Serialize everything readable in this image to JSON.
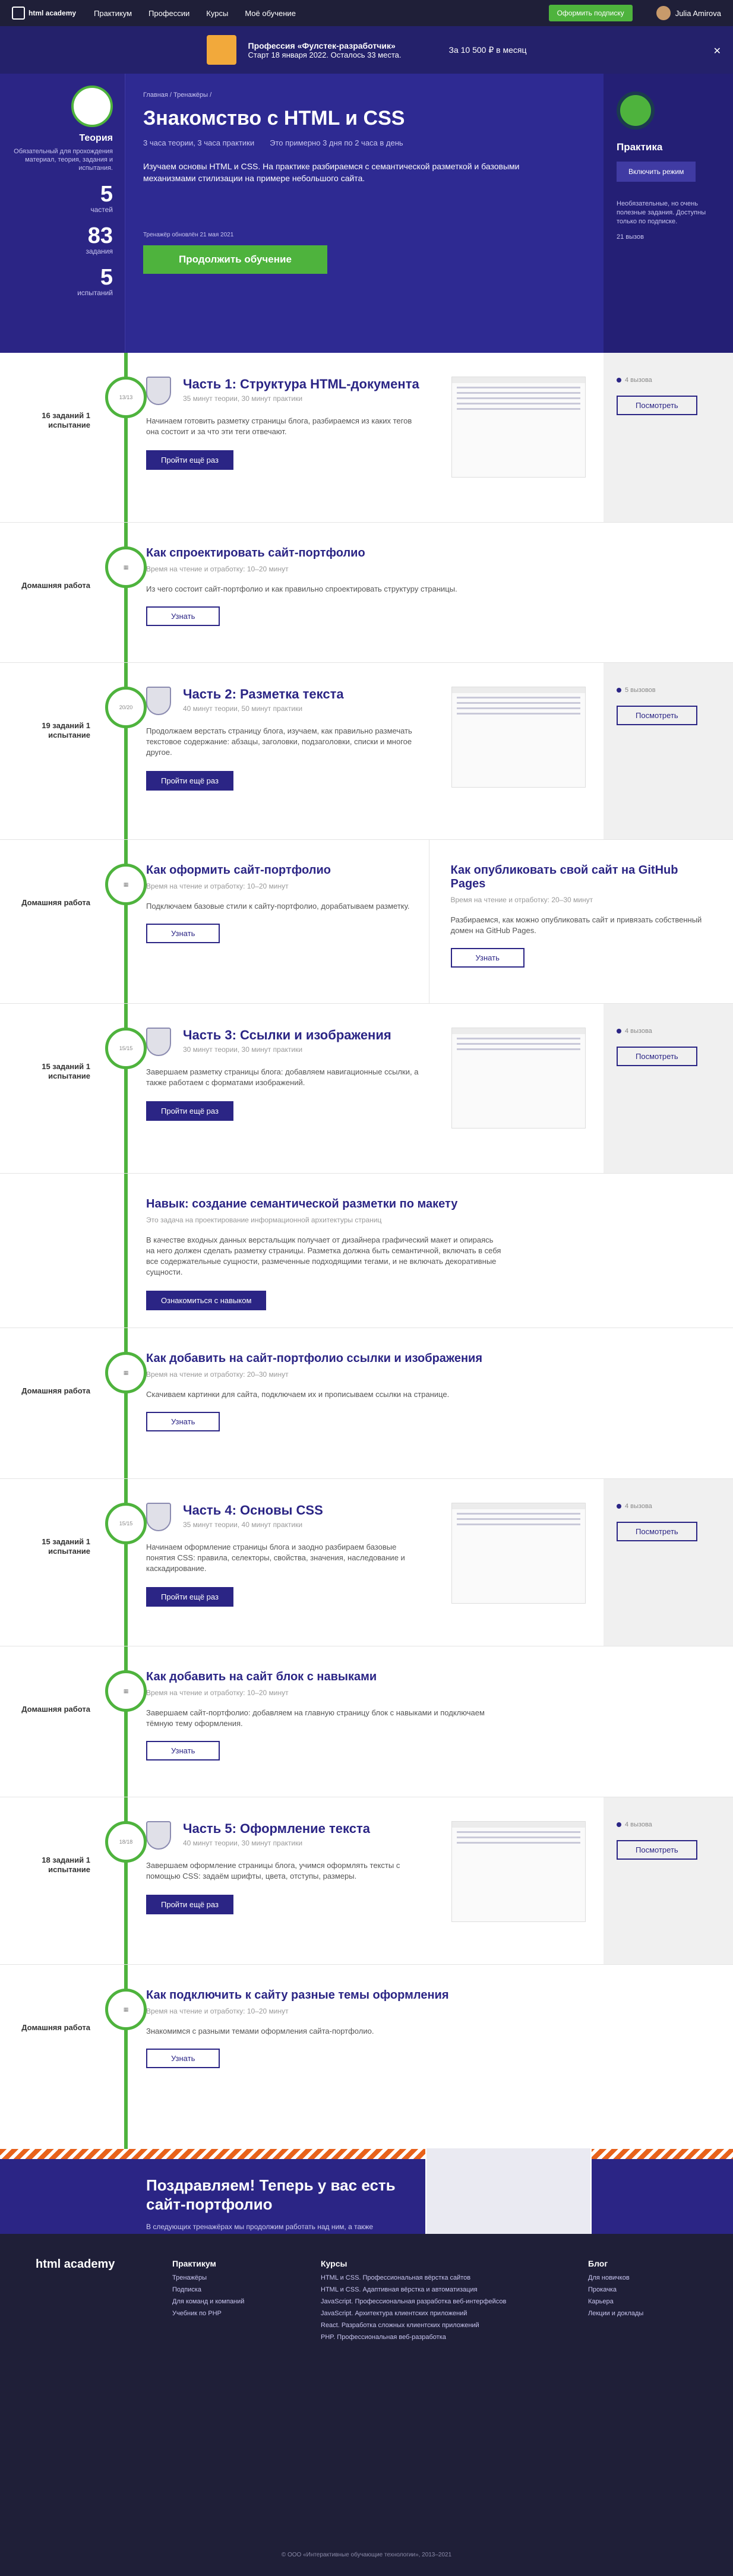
{
  "nav": {
    "logo": "html academy",
    "items": [
      "Практикум",
      "Профессии",
      "Курсы",
      "Моё обучение"
    ],
    "subscribe": "Оформить подписку",
    "user": "Julia Amirova"
  },
  "promo": {
    "title": "Профессия «Фулстек-разработчик»",
    "subtitle": "Старт 18 января 2022. Осталось 33 места.",
    "price": "За 10 500 ₽ в месяц"
  },
  "hero": {
    "theory_title": "Теория",
    "theory_desc": "Обязательный для прохождения материал, теория, задания и испытания.",
    "stats": [
      {
        "num": "5",
        "label": "частей"
      },
      {
        "num": "83",
        "label": "задания"
      },
      {
        "num": "5",
        "label": "испытаний"
      }
    ],
    "breadcrumbs": "Главная / Тренажёры /",
    "title": "Знакомство с HTML и CSS",
    "meta_1": "3 часа теории, 3 часа практики",
    "meta_2": "Это примерно 3 дня по 2 часа в день",
    "text": "Изучаем основы HTML и CSS. На практике разбираемся с семантической разметкой и базовыми механизмами стилизации на примере небольшого сайта.",
    "updated": "Тренажёр обновлён 21 мая 2021",
    "start": "Продолжить обучение",
    "practice_title": "Практика",
    "practice_btn": "Включить режим",
    "practice_text": "Необязательные, но очень полезные задания. Доступны только по подписке.",
    "practice_views": "21 вызов"
  },
  "sections": [
    {
      "label": "16 заданий 1 испытание",
      "title": "Часть 1: Структура HTML-документа",
      "meta": "35 минут теории, 30 минут практики",
      "text": "Начинаем готовить разметку страницы блога, разбираемся из каких тегов она состоит и за что эти теги отвечают.",
      "btn": "Пройти ещё раз",
      "views": "4 вызова",
      "side_btn": "Посмотреть"
    },
    {
      "label": "Домашняя работа",
      "title": "Как спроектировать сайт-портфолио",
      "meta": "Время на чтение и отработку: 10–20 минут",
      "text": "Из чего состоит сайт-портфолио и как правильно спроектировать структуру страницы.",
      "btn": "Узнать"
    },
    {
      "label": "19 заданий 1 испытание",
      "title": "Часть 2: Разметка текста",
      "meta": "40 минут теории, 50 минут практики",
      "text": "Продолжаем верстать страницу блога, изучаем, как правильно размечать текстовое содержание: абзацы, заголовки, подзаголовки, списки и многое другое.",
      "btn": "Пройти ещё раз",
      "views": "5 вызовов",
      "side_btn": "Посмотреть"
    },
    {
      "label": "Домашняя работа",
      "title": "Как оформить сайт-портфолио",
      "meta": "Время на чтение и отработку: 10–20 минут",
      "text": "Подключаем базовые стили к сайту-портфолио, дорабатываем разметку.",
      "btn": "Узнать",
      "title2": "Как опубликовать свой сайт на GitHub Pages",
      "meta2": "Время на чтение и отработку: 20–30 минут",
      "text2": "Разбираемся, как можно опубликовать сайт и привязать собственный домен на GitHub Pages.",
      "btn2": "Узнать"
    },
    {
      "label": "15 заданий 1 испытание",
      "title": "Часть 3: Ссылки и изображения",
      "meta": "30 минут теории, 30 минут практики",
      "text": "Завершаем разметку страницы блога: добавляем навигационные ссылки, а также работаем с форматами изображений.",
      "btn": "Пройти ещё раз",
      "views": "4 вызова",
      "side_btn": "Посмотреть"
    },
    {
      "label": "",
      "title": "Навык: создание семантической разметки по макету",
      "meta": "Это задача на проектирование информационной архитектуры страниц",
      "text": "В качестве входных данных верстальщик получает от дизайнера графический макет и опираясь на него должен сделать разметку страницы. Разметка должна быть семантичной, включать в себя все содержательные сущности, размеченные подходящими тегами, и не включать декоративные сущности.",
      "btn": "Ознакомиться с навыком"
    },
    {
      "label": "Домашняя работа",
      "title": "Как добавить на сайт-портфолио ссылки и изображения",
      "meta": "Время на чтение и отработку: 20–30 минут",
      "text": "Скачиваем картинки для сайта, подключаем их и прописываем ссылки на странице.",
      "btn": "Узнать"
    },
    {
      "label": "15 заданий 1 испытание",
      "title": "Часть 4: Основы CSS",
      "meta": "35 минут теории, 40 минут практики",
      "text": "Начинаем оформление страницы блога и заодно разбираем базовые понятия CSS: правила, селекторы, свойства, значения, наследование и каскадирование.",
      "btn": "Пройти ещё раз",
      "views": "4 вызова",
      "side_btn": "Посмотреть"
    },
    {
      "label": "Домашняя работа",
      "title": "Как добавить на сайт блок с навыками",
      "meta": "Время на чтение и отработку: 10–20 минут",
      "text": "Завершаем сайт-портфолио: добавляем на главную страницу блок с навыками и подключаем тёмную тему оформления.",
      "btn": "Узнать"
    },
    {
      "label": "18 заданий 1 испытание",
      "title": "Часть 5: Оформление текста",
      "meta": "40 минут теории, 30 минут практики",
      "text": "Завершаем оформление страницы блога, учимся оформлять тексты с помощью CSS: задаём шрифты, цвета, отступы, размеры.",
      "btn": "Пройти ещё раз",
      "views": "4 вызова",
      "side_btn": "Посмотреть"
    },
    {
      "label": "Домашняя работа",
      "title": "Как подключить к сайту разные темы оформления",
      "meta": "Время на чтение и отработку: 10–20 минут",
      "text": "Знакомимся с разными темами оформления сайта-портфолио.",
      "btn": "Узнать"
    }
  ],
  "congrats": {
    "title": "Поздравляем! Теперь у вас есть сайт-портфолио",
    "text": "В следующих тренажёрах мы продолжим работать над ним, а также дополним портфолио новыми проектами."
  },
  "footer": {
    "cols": [
      {
        "title": "Практикум",
        "items": [
          "Тренажёры",
          "Подписка",
          "Для команд и компаний",
          "Учебник по PHP"
        ]
      },
      {
        "title": "Курсы",
        "items": [
          "HTML и CSS. Профессиональная вёрстка сайтов",
          "HTML и CSS. Адаптивная вёрстка и автоматизация",
          "JavaScript. Профессиональная разработка веб-интерфейсов",
          "JavaScript. Архитектура клиентских приложений",
          "React. Разработка сложных клиентских приложений",
          "PHP. Профессиональная веб-разработка"
        ]
      },
      {
        "title": "Блог",
        "items": [
          "Для новичков",
          "Прокачка",
          "Карьера",
          "Лекции и доклады"
        ]
      }
    ],
    "copyright": "© ООО «Интерактивные обучающие технологии», 2013–2021"
  }
}
